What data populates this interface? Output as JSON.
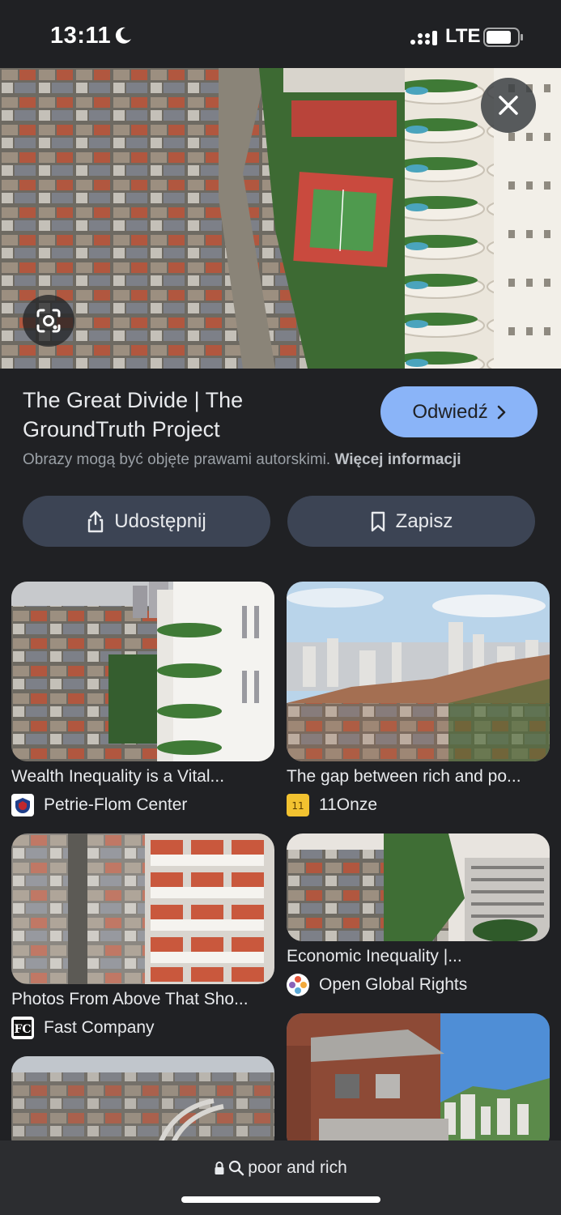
{
  "status": {
    "time": "13:11",
    "network": "LTE"
  },
  "result": {
    "title": "The Great Divide | The GroundTruth Project",
    "visit_label": "Odwiedź",
    "copyright_text": "Obrazy mogą być objęte prawami autorskimi.",
    "more_info_label": "Więcej informacji",
    "share_label": "Udostępnij",
    "save_label": "Zapisz"
  },
  "related": [
    {
      "title": "Wealth Inequality is a Vital...",
      "source": "Petrie-Flom Center"
    },
    {
      "title": "The gap between rich and po...",
      "source": "11Onze"
    },
    {
      "title": "Photos From Above That Sho...",
      "source": "Fast Company"
    },
    {
      "title": "Economic Inequality |...",
      "source": "Open Global Rights"
    }
  ],
  "search": {
    "query": "poor and rich"
  },
  "colors": {
    "background": "#202124",
    "accent": "#8ab4f8",
    "button_bg": "#3c4454"
  },
  "icons": [
    "moon-icon",
    "signal-icon",
    "battery-icon",
    "close-icon",
    "lens-icon",
    "chevron-right-icon",
    "share-icon",
    "bookmark-icon",
    "lock-icon",
    "search-icon"
  ]
}
